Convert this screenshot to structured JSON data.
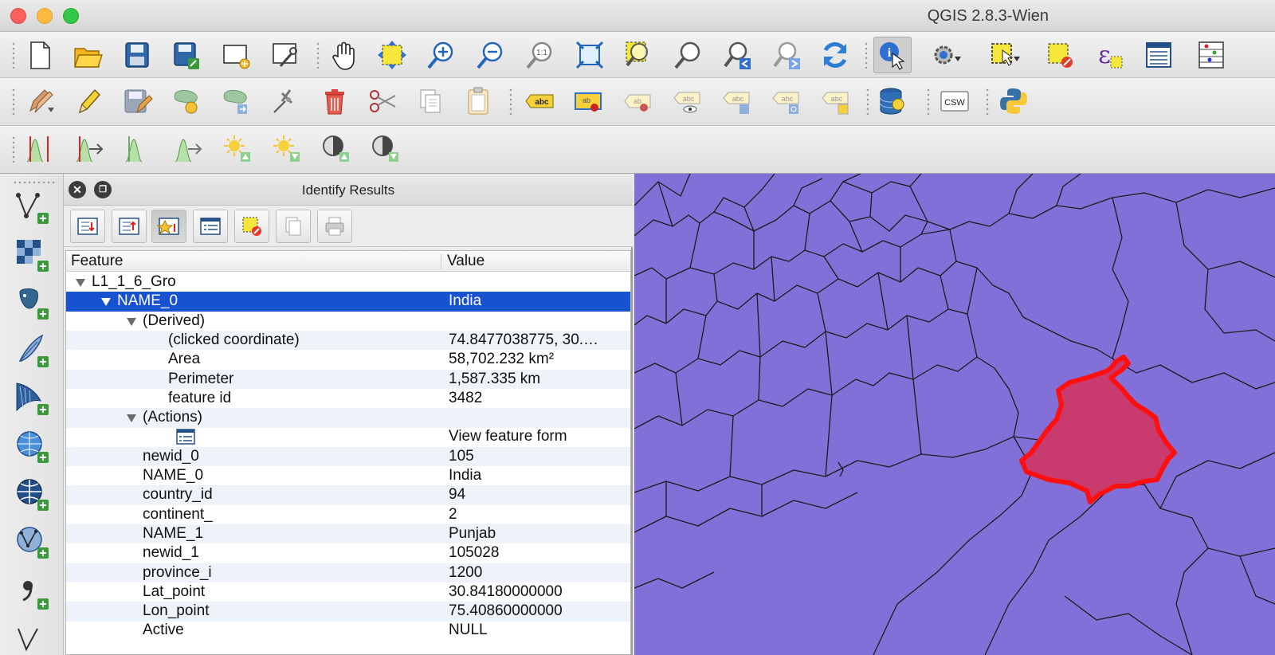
{
  "app": {
    "title": "QGIS 2.8.3-Wien"
  },
  "colors": {
    "map_background": "#8270d8",
    "selection_fill": "#c93a6e",
    "selection_stroke": "#ff1010",
    "row_selected": "#1852d1"
  },
  "toolbar1": {
    "icons": [
      "new-project-icon",
      "open-project-icon",
      "save-project-icon",
      "save-as-icon",
      "new-print-composer-icon",
      "composer-manager-icon",
      "pan-icon",
      "pan-to-selection-icon",
      "zoom-in-icon",
      "zoom-out-icon",
      "zoom-actual-icon",
      "zoom-full-icon",
      "zoom-to-selection-icon",
      "zoom-to-layer-icon",
      "zoom-last-icon",
      "zoom-next-icon",
      "refresh-icon",
      "identify-icon",
      "run-feature-action-icon",
      "select-feature-icon",
      "deselect-icon",
      "field-calculator-icon",
      "attribute-table-icon",
      "statistics-icon"
    ]
  },
  "toolbar2": {
    "icons": [
      "current-edits-icon",
      "toggle-editing-icon",
      "save-edits-icon",
      "add-feature-icon",
      "move-feature-icon",
      "node-tool-icon",
      "delete-selected-icon",
      "cut-features-icon",
      "copy-features-icon",
      "paste-features-icon",
      "label-icon",
      "pin-labels-icon",
      "highlight-pinned-icon",
      "show-hide-labels-icon",
      "move-label-icon",
      "rotate-label-icon",
      "change-label-icon",
      "db-manager-icon",
      "metasearch-icon",
      "python-console-icon"
    ],
    "csw_text": "CSW"
  },
  "toolbar3": {
    "icons": [
      "raster-histogram-stretch-icon",
      "raster-cumulative-cut-icon",
      "raster-local-stretch-icon",
      "raster-local-cumulative-icon",
      "increase-brightness-icon",
      "decrease-brightness-icon",
      "increase-contrast-icon",
      "decrease-contrast-icon"
    ]
  },
  "left_toolbar": {
    "icons": [
      "add-vector-layer-icon",
      "add-raster-layer-icon",
      "add-postgis-layer-icon",
      "add-spatialite-layer-icon",
      "add-mssql-layer-icon",
      "add-wms-layer-icon",
      "add-wcs-layer-icon",
      "add-wfs-layer-icon",
      "add-delimited-text-icon"
    ]
  },
  "identify": {
    "title": "Identify Results",
    "tool_icons": [
      "expand-tree-icon",
      "collapse-tree-icon",
      "expand-new-results-icon",
      "open-form-icon",
      "clear-results-icon",
      "copy-feature-icon",
      "print-icon"
    ],
    "columns": {
      "feature": "Feature",
      "value": "Value"
    },
    "rows": [
      {
        "k": "L1_1_6_Gro",
        "v": "",
        "level": 0,
        "expander": true
      },
      {
        "k": "NAME_0",
        "v": "India",
        "level": 1,
        "expander": true,
        "selected": true
      },
      {
        "k": "(Derived)",
        "v": "",
        "level": 2,
        "expander": true
      },
      {
        "k": "(clicked coordinate)",
        "v": "74.8477038775, 30.…",
        "level": 3
      },
      {
        "k": "Area",
        "v": "58,702.232 km²",
        "level": 3
      },
      {
        "k": "Perimeter",
        "v": "1,587.335 km",
        "level": 3
      },
      {
        "k": "feature id",
        "v": "3482",
        "level": 3
      },
      {
        "k": "(Actions)",
        "v": "",
        "level": 2,
        "expander": true
      },
      {
        "k": "",
        "v": "View feature form",
        "level": 3,
        "form_icon": true
      },
      {
        "k": "newid_0",
        "v": "105",
        "level": 2
      },
      {
        "k": "NAME_0",
        "v": "India",
        "level": 2
      },
      {
        "k": "country_id",
        "v": "94",
        "level": 2
      },
      {
        "k": "continent_",
        "v": "2",
        "level": 2
      },
      {
        "k": "NAME_1",
        "v": "Punjab",
        "level": 2
      },
      {
        "k": "newid_1",
        "v": "105028",
        "level": 2
      },
      {
        "k": "province_i",
        "v": "1200",
        "level": 2
      },
      {
        "k": "Lat_point",
        "v": "30.84180000000",
        "level": 2
      },
      {
        "k": "Lon_point",
        "v": "75.40860000000",
        "level": 2
      },
      {
        "k": "Active",
        "v": "NULL",
        "level": 2
      }
    ]
  }
}
